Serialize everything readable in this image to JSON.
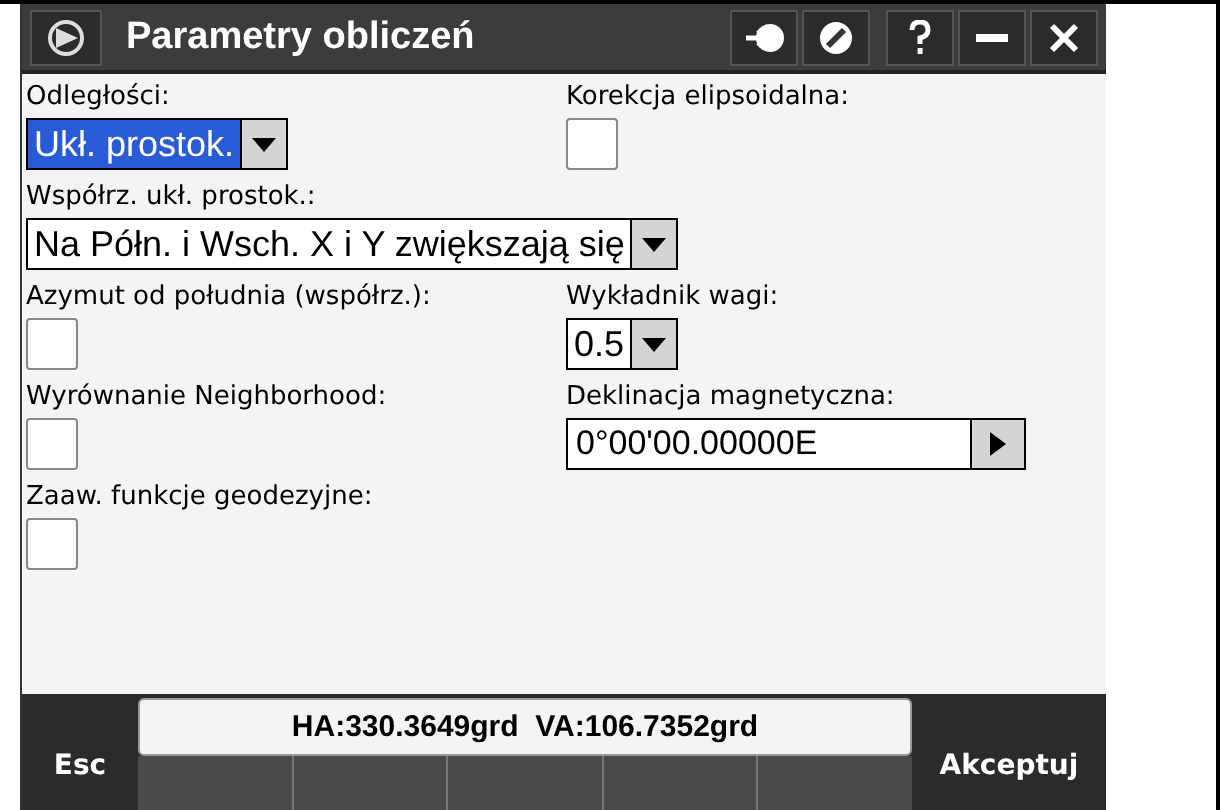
{
  "window": {
    "title": "Parametry obliczeń"
  },
  "form_rows": [
    {
      "items": [
        {
          "kind": "dropdown",
          "label": "Odległości:",
          "value": "Ukł. prostok.",
          "focused": true
        },
        {
          "kind": "checkbox",
          "label": "Korekcja elipsoidalna:",
          "checked": false
        }
      ]
    },
    {
      "items": [
        {
          "kind": "dropdown",
          "label": "Współrz. ukł. prostok.:",
          "value": "Na Półn. i Wsch. X i Y zwiększają się",
          "focused": false
        }
      ]
    },
    {
      "items": [
        {
          "kind": "checkbox",
          "label": "Azymut od południa (współrz.):",
          "checked": false
        },
        {
          "kind": "dropdown",
          "label": "Wykładnik wagi:",
          "value": "0.5",
          "focused": false
        }
      ]
    },
    {
      "items": [
        {
          "kind": "checkbox",
          "label": "Wyrównanie Neighborhood:",
          "checked": false
        },
        {
          "kind": "angle",
          "label": "Deklinacja magnetyczna:",
          "value": "0°00'00.00000E"
        }
      ]
    },
    {
      "items": [
        {
          "kind": "checkbox",
          "label": "Zaaw. funkcje geodezyjne:",
          "checked": false
        }
      ]
    }
  ],
  "status": "HA:330.3649grd  VA:106.7352grd",
  "buttons": {
    "left": "Esc",
    "right": "Akceptuj"
  }
}
